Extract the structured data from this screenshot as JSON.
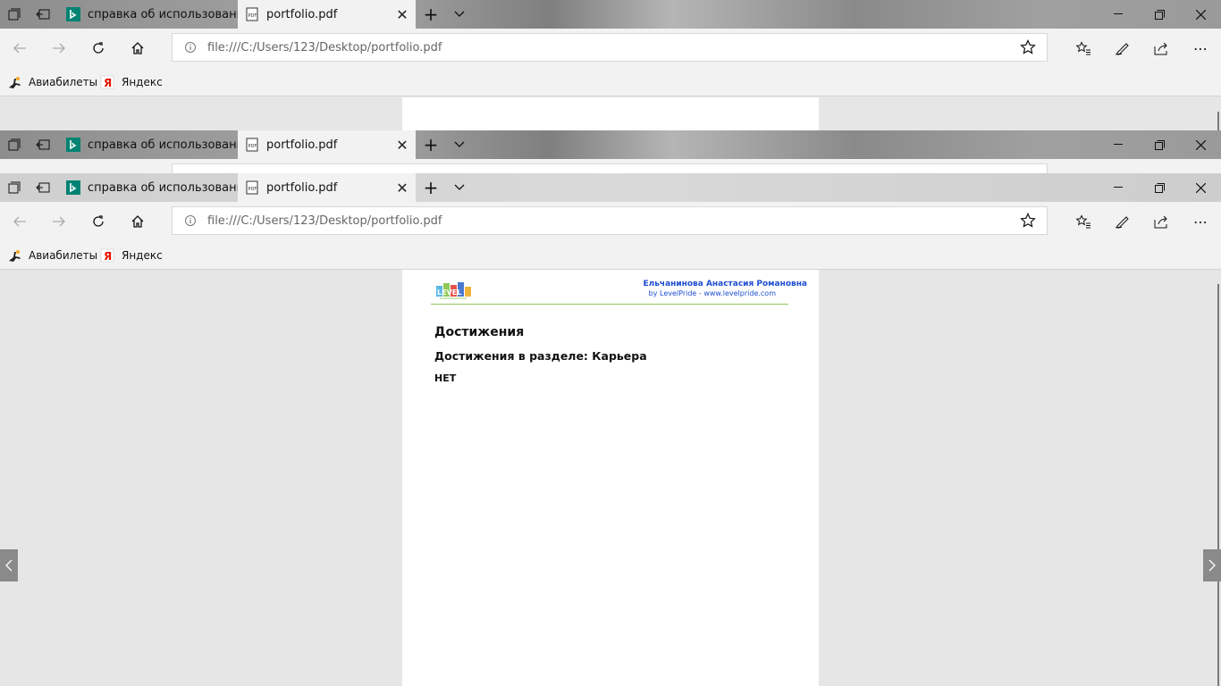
{
  "tabs": {
    "inactive_title": "справка об использовании",
    "active_title": "portfolio.pdf"
  },
  "address": {
    "url": "file:///C:/Users/123/Desktop/portfolio.pdf"
  },
  "favorites": [
    {
      "label": "Авиабилеты",
      "icon": "plane-icon"
    },
    {
      "label": "Яндекс",
      "icon": "yandex-icon"
    }
  ],
  "pdf": {
    "logo_text": "LEVEL",
    "author": "Ельчанинова Анастасия Романовна",
    "byline": "by LevelPride - www.levelpride.com",
    "heading": "Достижения",
    "subheading": "Достижения в разделе: Карьера",
    "body": "НЕТ"
  },
  "colors": {
    "accent_blue": "#1f4fd1",
    "rule_green": "#8fc857",
    "bing_teal": "#008373"
  }
}
